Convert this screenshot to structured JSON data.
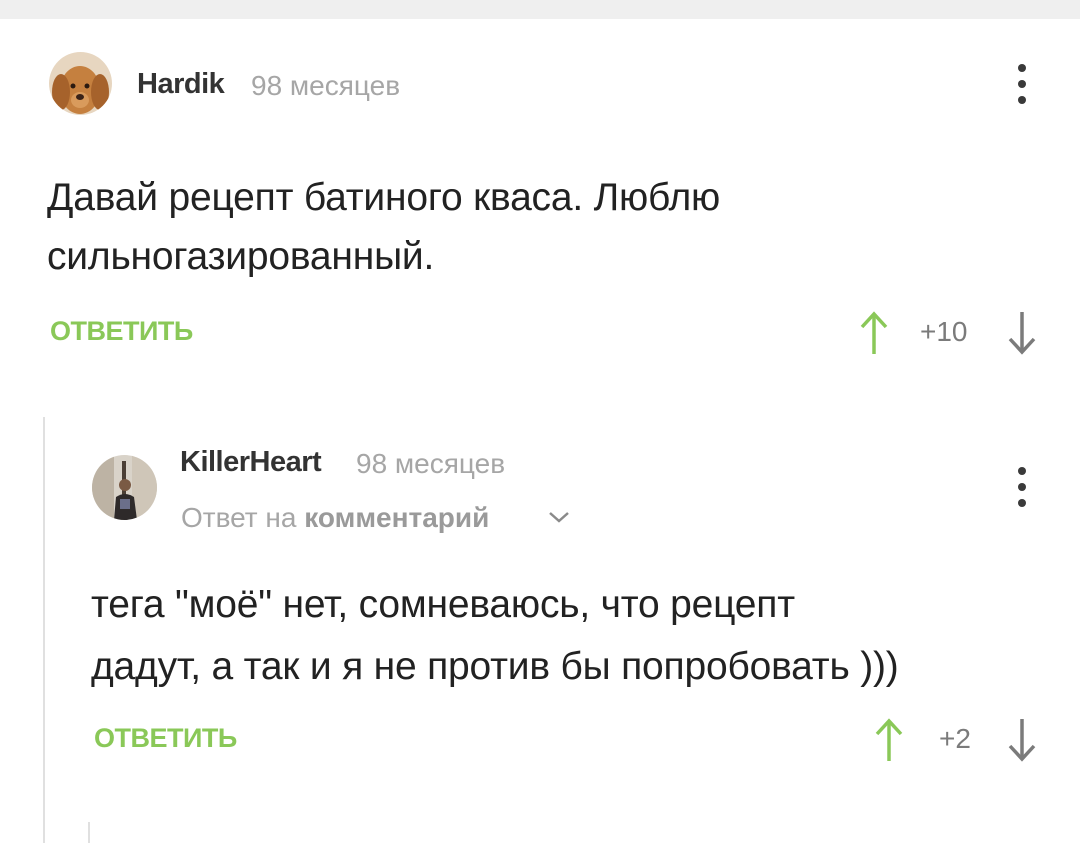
{
  "comments": [
    {
      "author": "Hardik",
      "time": "98 месяцев",
      "text_line1": "Давай рецепт батиного кваса. Люблю",
      "text_line2": "сильногазированный.",
      "reply_label": "ОТВЕТИТЬ",
      "rating": "+10",
      "avatar_icon": "dog-avatar",
      "menu_icon": "kebab-menu-icon"
    },
    {
      "author": "KillerHeart",
      "time": "98 месяцев",
      "reply_to_prefix": "Ответ на",
      "reply_to_link": "комментарий",
      "text_line1": "тега \"моё\" нет, сомневаюсь, что рецепт",
      "text_line2": "дадут, а так и я не против бы попробовать )))",
      "reply_label": "ОТВЕТИТЬ",
      "rating": "+2",
      "avatar_icon": "user-photo-avatar",
      "menu_icon": "kebab-menu-icon"
    }
  ],
  "colors": {
    "accent_green": "#8ac858",
    "text_dark": "#222222",
    "muted": "#a6a6a6",
    "vote_up": "#8ac858",
    "vote_down": "#7b7b7b"
  }
}
